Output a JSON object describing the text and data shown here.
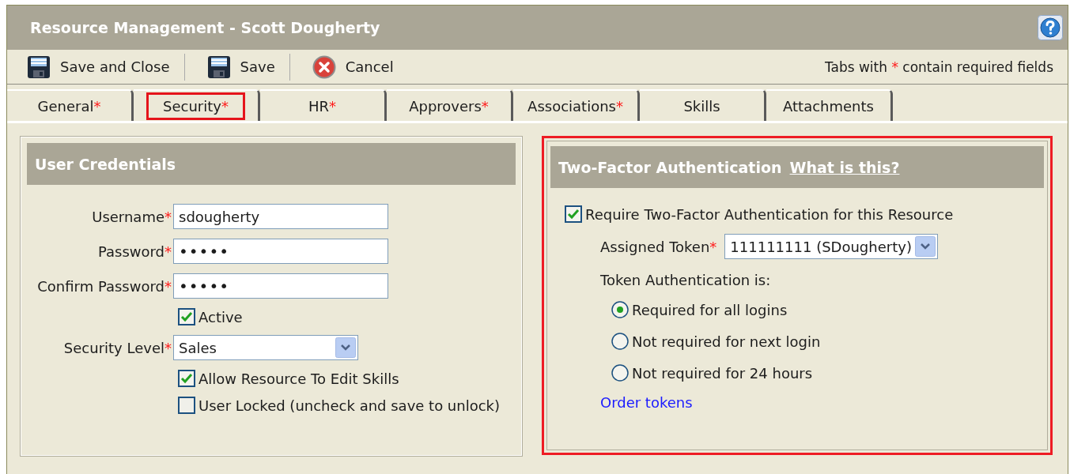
{
  "window": {
    "title": "Resource Management - Scott Dougherty"
  },
  "toolbar": {
    "buttons": [
      {
        "label": "Save and Close",
        "kind": "save"
      },
      {
        "label": "Save",
        "kind": "save"
      },
      {
        "label": "Cancel",
        "kind": "cancel"
      }
    ],
    "note": {
      "before": "Tabs with",
      "mark": "*",
      "after": "contain required fields"
    }
  },
  "tabs": [
    {
      "label": "General",
      "mark": "*",
      "highlighted": false
    },
    {
      "label": "Security",
      "mark": "*",
      "highlighted": true
    },
    {
      "label": "HR",
      "mark": "*",
      "highlighted": false
    },
    {
      "label": "Approvers",
      "mark": "*",
      "highlighted": false
    },
    {
      "label": "Associations",
      "mark": "*",
      "highlighted": false
    },
    {
      "label": "Skills",
      "highlighted": false
    },
    {
      "label": "Attachments",
      "highlighted": false
    }
  ],
  "credentials": {
    "title": "User Credentials",
    "highlighted": false,
    "fields": [
      {
        "kind": "text",
        "label": "Username",
        "mark": "*",
        "value": "sdougherty"
      },
      {
        "kind": "password",
        "label": "Password",
        "mark": "*",
        "value": "•••••"
      },
      {
        "kind": "password",
        "label": "Confirm Password",
        "mark": "*",
        "value": "•••••"
      },
      {
        "kind": "checkbox",
        "label": "Active",
        "checked": true
      },
      {
        "kind": "select",
        "label": "Security Level",
        "mark": "*",
        "value": "Sales"
      },
      {
        "kind": "checkbox",
        "label": "Allow Resource To Edit Skills",
        "checked": true
      },
      {
        "kind": "checkbox",
        "label": "User Locked (uncheck and save to unlock)",
        "checked": false
      }
    ]
  },
  "two_factor": {
    "title": "Two-Factor Authentication",
    "help_link": "What is this?",
    "highlighted": true,
    "require": {
      "label": "Require Two-Factor Authentication for this Resource",
      "checked": true
    },
    "token": {
      "label": "Assigned Token",
      "mark": "*",
      "value": "111111111 (SDougherty)"
    },
    "mode_label": "Token Authentication is:",
    "modes": [
      {
        "label": "Required for all logins",
        "selected": true
      },
      {
        "label": "Not required for next login",
        "selected": false
      },
      {
        "label": "Not required for 24 hours",
        "selected": false
      }
    ],
    "order_link": "Order tokens"
  }
}
